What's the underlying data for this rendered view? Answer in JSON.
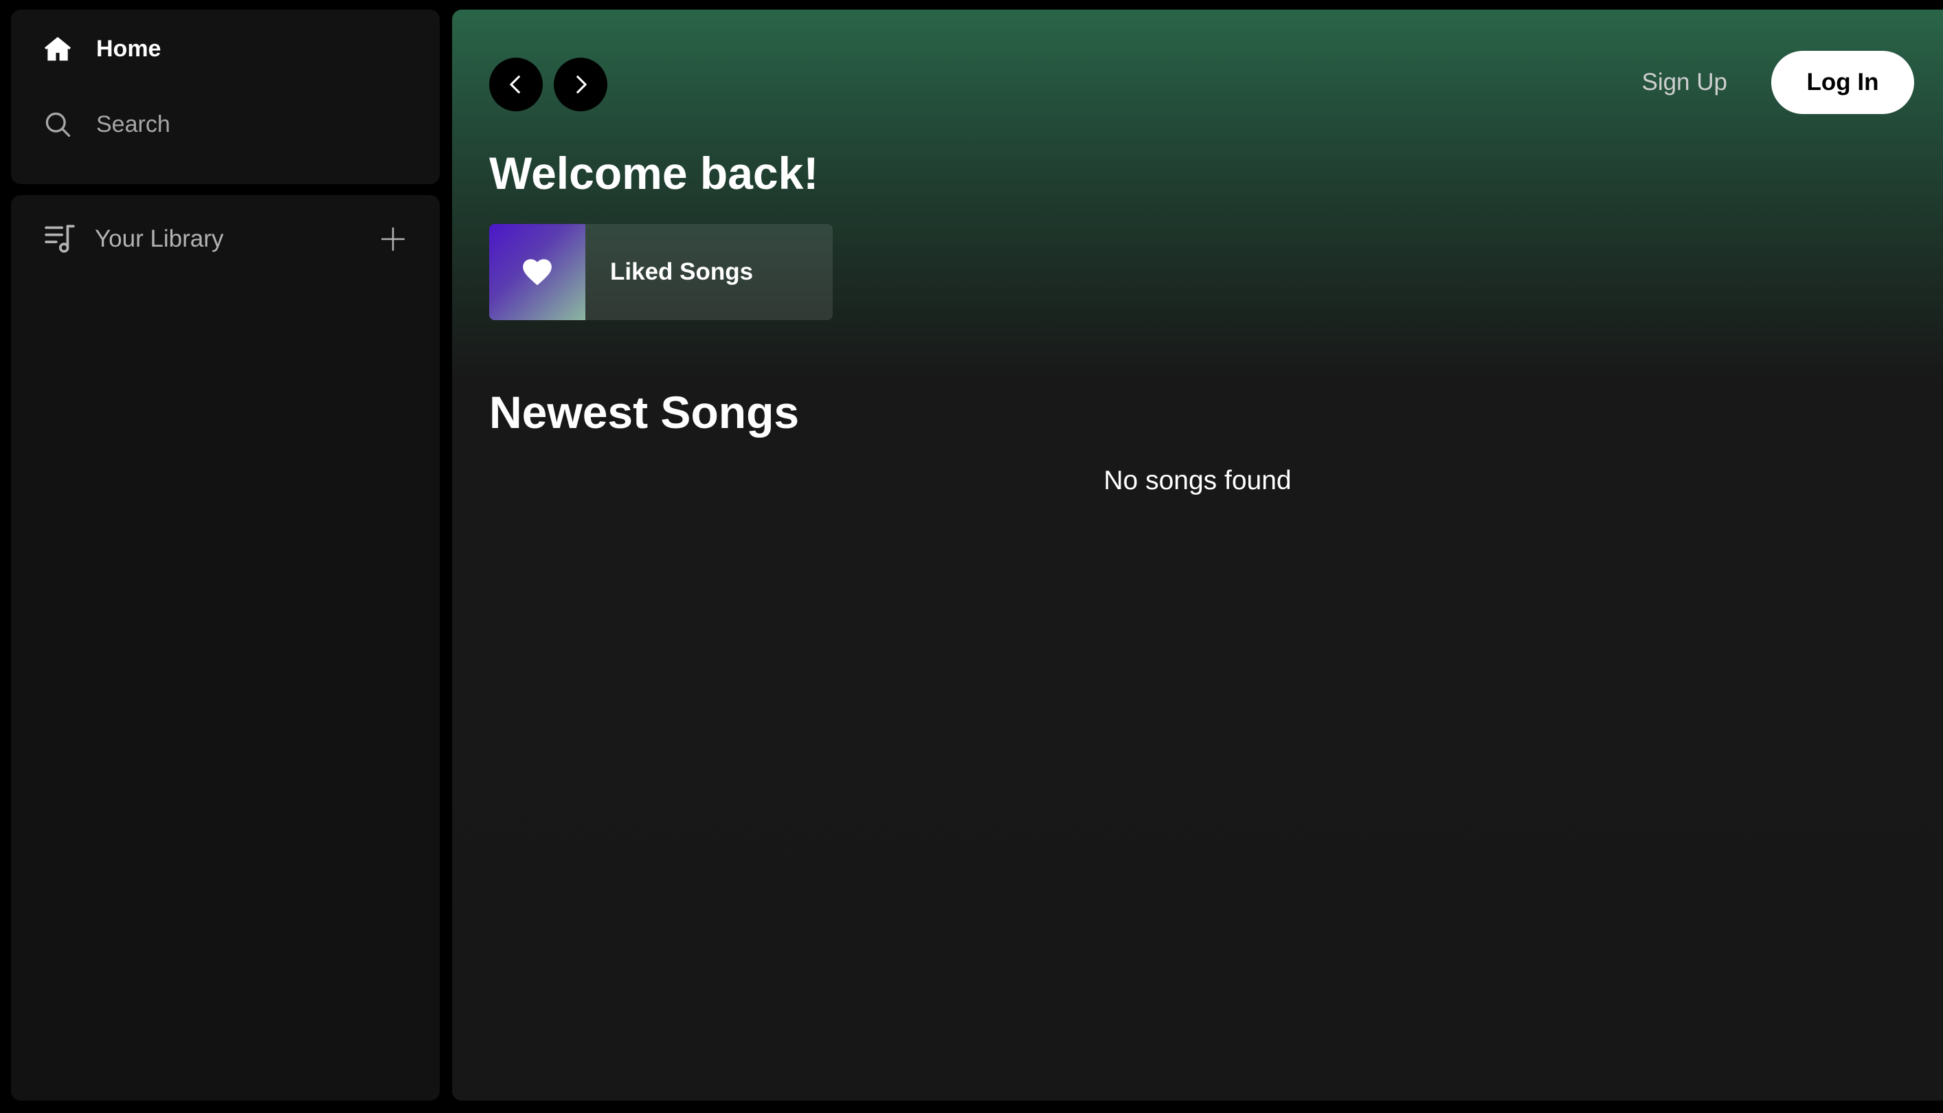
{
  "sidebar": {
    "nav": {
      "home_label": "Home",
      "search_label": "Search"
    },
    "library": {
      "title": "Your Library"
    }
  },
  "header": {
    "sign_up_label": "Sign Up",
    "log_in_label": "Log In"
  },
  "main": {
    "greeting": "Welcome back!",
    "liked_songs_label": "Liked Songs",
    "newest_songs_title": "Newest Songs",
    "empty_message": "No songs found"
  },
  "icons": {
    "home": "home-icon",
    "search": "search-icon",
    "library": "library-icon",
    "add": "plus-icon",
    "back": "chevron-left-icon",
    "forward": "chevron-right-icon",
    "heart": "heart-icon"
  },
  "colors": {
    "background": "#000000",
    "panel": "#121212",
    "header_gradient_top": "#2a6548",
    "main_bg": "#171717",
    "liked_art_start": "#4b17c8",
    "liked_art_end": "#8bb7a0",
    "text_primary": "#ffffff",
    "text_secondary": "#a7a7a7"
  }
}
